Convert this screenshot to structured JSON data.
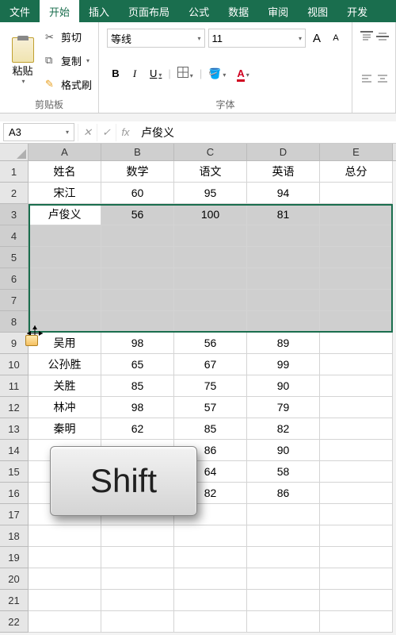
{
  "menu": {
    "items": [
      "文件",
      "开始",
      "插入",
      "页面布局",
      "公式",
      "数据",
      "审阅",
      "视图",
      "开发"
    ],
    "active_index": 1
  },
  "ribbon": {
    "clipboard": {
      "paste": "粘贴",
      "cut": "剪切",
      "copy": "复制",
      "format_painter": "格式刷",
      "group_label": "剪贴板"
    },
    "font": {
      "name": "等线",
      "size": "11",
      "increase": "A",
      "decrease": "A",
      "bold": "B",
      "italic": "I",
      "underline": "U",
      "font_color_letter": "A",
      "group_label": "字体"
    }
  },
  "name_box": "A3",
  "formula_value": "卢俊义",
  "fx_label": "fx",
  "columns": [
    "A",
    "B",
    "C",
    "D",
    "E"
  ],
  "row_headers": [
    "1",
    "2",
    "3",
    "4",
    "5",
    "6",
    "7",
    "8",
    "9",
    "10",
    "11",
    "12",
    "13",
    "14",
    "15",
    "16",
    "17",
    "18",
    "19",
    "20",
    "21",
    "22"
  ],
  "chart_data": {
    "type": "table",
    "columns": [
      "姓名",
      "数学",
      "语文",
      "英语",
      "总分"
    ],
    "rows": [
      {
        "姓名": "宋江",
        "数学": 60,
        "语文": 95,
        "英语": 94,
        "总分": ""
      },
      {
        "姓名": "卢俊义",
        "数学": 56,
        "语文": 100,
        "英语": 81,
        "总分": ""
      },
      {
        "姓名": "",
        "数学": "",
        "语文": "",
        "英语": "",
        "总分": ""
      },
      {
        "姓名": "",
        "数学": "",
        "语文": "",
        "英语": "",
        "总分": ""
      },
      {
        "姓名": "",
        "数学": "",
        "语文": "",
        "英语": "",
        "总分": ""
      },
      {
        "姓名": "",
        "数学": "",
        "语文": "",
        "英语": "",
        "总分": ""
      },
      {
        "姓名": "",
        "数学": "",
        "语文": "",
        "英语": "",
        "总分": ""
      },
      {
        "姓名": "吴用",
        "数学": 98,
        "语文": 56,
        "英语": 89,
        "总分": ""
      },
      {
        "姓名": "公孙胜",
        "数学": 65,
        "语文": 67,
        "英语": 99,
        "总分": ""
      },
      {
        "姓名": "关胜",
        "数学": 85,
        "语文": 75,
        "英语": 90,
        "总分": ""
      },
      {
        "姓名": "林冲",
        "数学": 98,
        "语文": 57,
        "英语": 79,
        "总分": ""
      },
      {
        "姓名": "秦明",
        "数学": 62,
        "语文": 85,
        "英语": 82,
        "总分": ""
      },
      {
        "姓名": "",
        "数学": "",
        "语文": 86,
        "英语": 90,
        "总分": ""
      },
      {
        "姓名": "",
        "数学": "",
        "语文": 64,
        "英语": 58,
        "总分": ""
      },
      {
        "姓名": "",
        "数学": "",
        "语文": 82,
        "英语": 86,
        "总分": ""
      }
    ]
  },
  "selection": {
    "active": "A3",
    "range": "A3:E8"
  },
  "overlay_key": "Shift"
}
